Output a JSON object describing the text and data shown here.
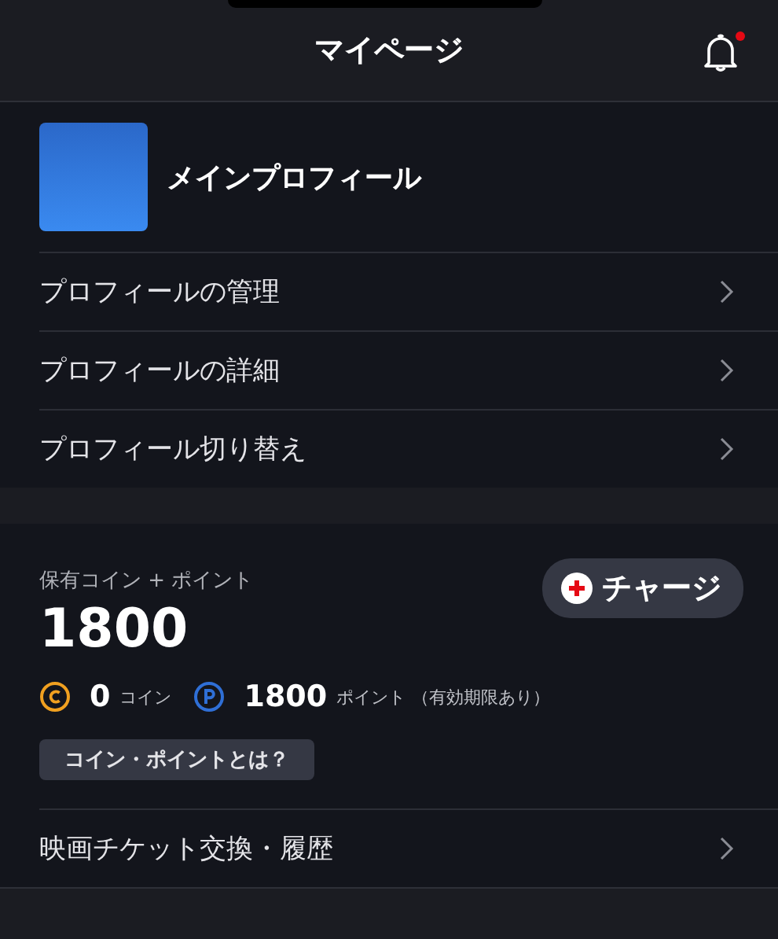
{
  "header": {
    "title": "マイページ",
    "notification_unread": true
  },
  "profile": {
    "name": "メインプロフィール",
    "menu": [
      {
        "label": "プロフィールの管理"
      },
      {
        "label": "プロフィールの詳細"
      },
      {
        "label": "プロフィール切り替え"
      }
    ]
  },
  "wallet": {
    "label": "保有コイン + ポイント",
    "total": "1800",
    "charge_button": "チャージ",
    "coins": {
      "value": "0",
      "unit": "コイン"
    },
    "points": {
      "value": "1800",
      "unit": "ポイント",
      "note": "（有効期限あり）"
    },
    "help_button": "コイン・ポイントとは？"
  },
  "menu": [
    {
      "label": "映画チケット交換・履歴"
    }
  ]
}
